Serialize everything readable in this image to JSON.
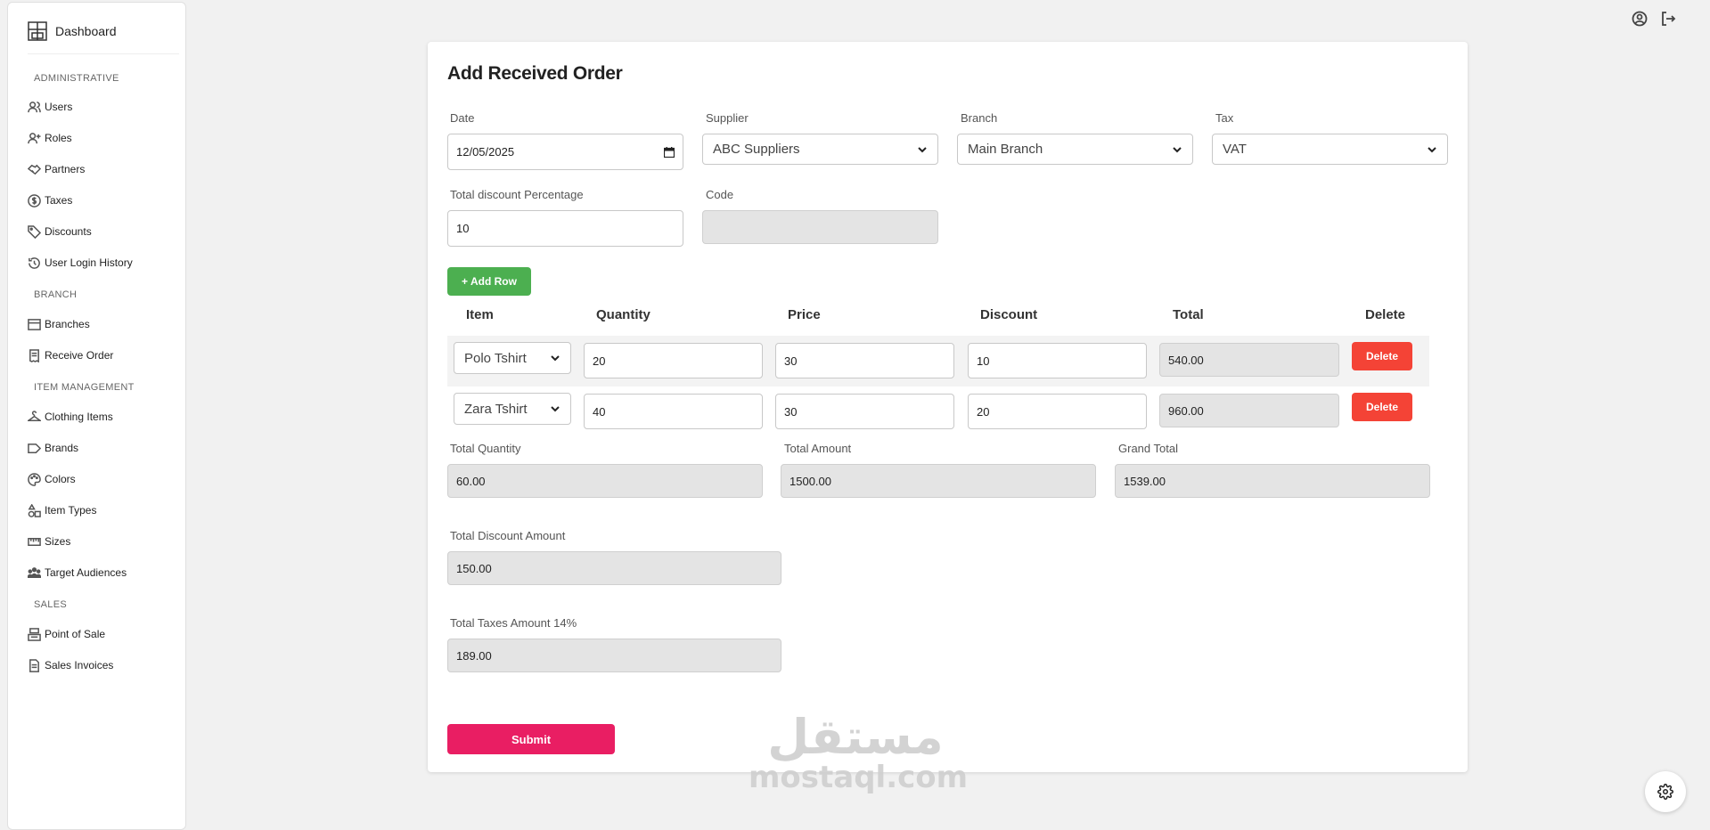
{
  "sidebar": {
    "brand": "Dashboard",
    "sections": [
      {
        "title": "ADMINISTRATIVE",
        "items": [
          "Users",
          "Roles",
          "Partners",
          "Taxes",
          "Discounts",
          "User Login History"
        ]
      },
      {
        "title": "BRANCH",
        "items": [
          "Branches",
          "Receive Order"
        ]
      },
      {
        "title": "ITEM MANAGEMENT",
        "items": [
          "Clothing Items",
          "Brands",
          "Colors",
          "Item Types",
          "Sizes",
          "Target Audiences"
        ]
      },
      {
        "title": "SALES",
        "items": [
          "Point of Sale",
          "Sales Invoices"
        ]
      }
    ]
  },
  "form": {
    "title": "Add Received Order",
    "date_label": "Date",
    "date_value": "12/05/2025",
    "supplier_label": "Supplier",
    "supplier_value": "ABC Suppliers",
    "branch_label": "Branch",
    "branch_value": "Main Branch",
    "tax_label": "Tax",
    "tax_value": "VAT",
    "discount_pct_label": "Total discount Percentage",
    "discount_pct_value": "10",
    "code_label": "Code",
    "code_value": "",
    "add_row_label": "+ Add Row",
    "columns": [
      "Item",
      "Quantity",
      "Price",
      "Discount",
      "Total",
      "Delete"
    ],
    "rows": [
      {
        "item": "Polo Tshirt",
        "quantity": "20",
        "price": "30",
        "discount": "10",
        "total": "540.00",
        "delete": "Delete"
      },
      {
        "item": "Zara Tshirt",
        "quantity": "40",
        "price": "30",
        "discount": "20",
        "total": "960.00",
        "delete": "Delete"
      }
    ],
    "total_quantity_label": "Total Quantity",
    "total_quantity_value": "60.00",
    "total_amount_label": "Total Amount",
    "total_amount_value": "1500.00",
    "grand_total_label": "Grand Total",
    "grand_total_value": "1539.00",
    "total_discount_label": "Total Discount Amount",
    "total_discount_value": "150.00",
    "total_taxes_label": "Total Taxes Amount 14%",
    "total_taxes_value": "189.00",
    "submit_label": "Submit"
  },
  "watermark": {
    "arabic": "مستقل",
    "latin": "mostaql.com"
  },
  "colors": {
    "add": "#4caf50",
    "delete": "#f44336",
    "submit": "#e91e63"
  }
}
